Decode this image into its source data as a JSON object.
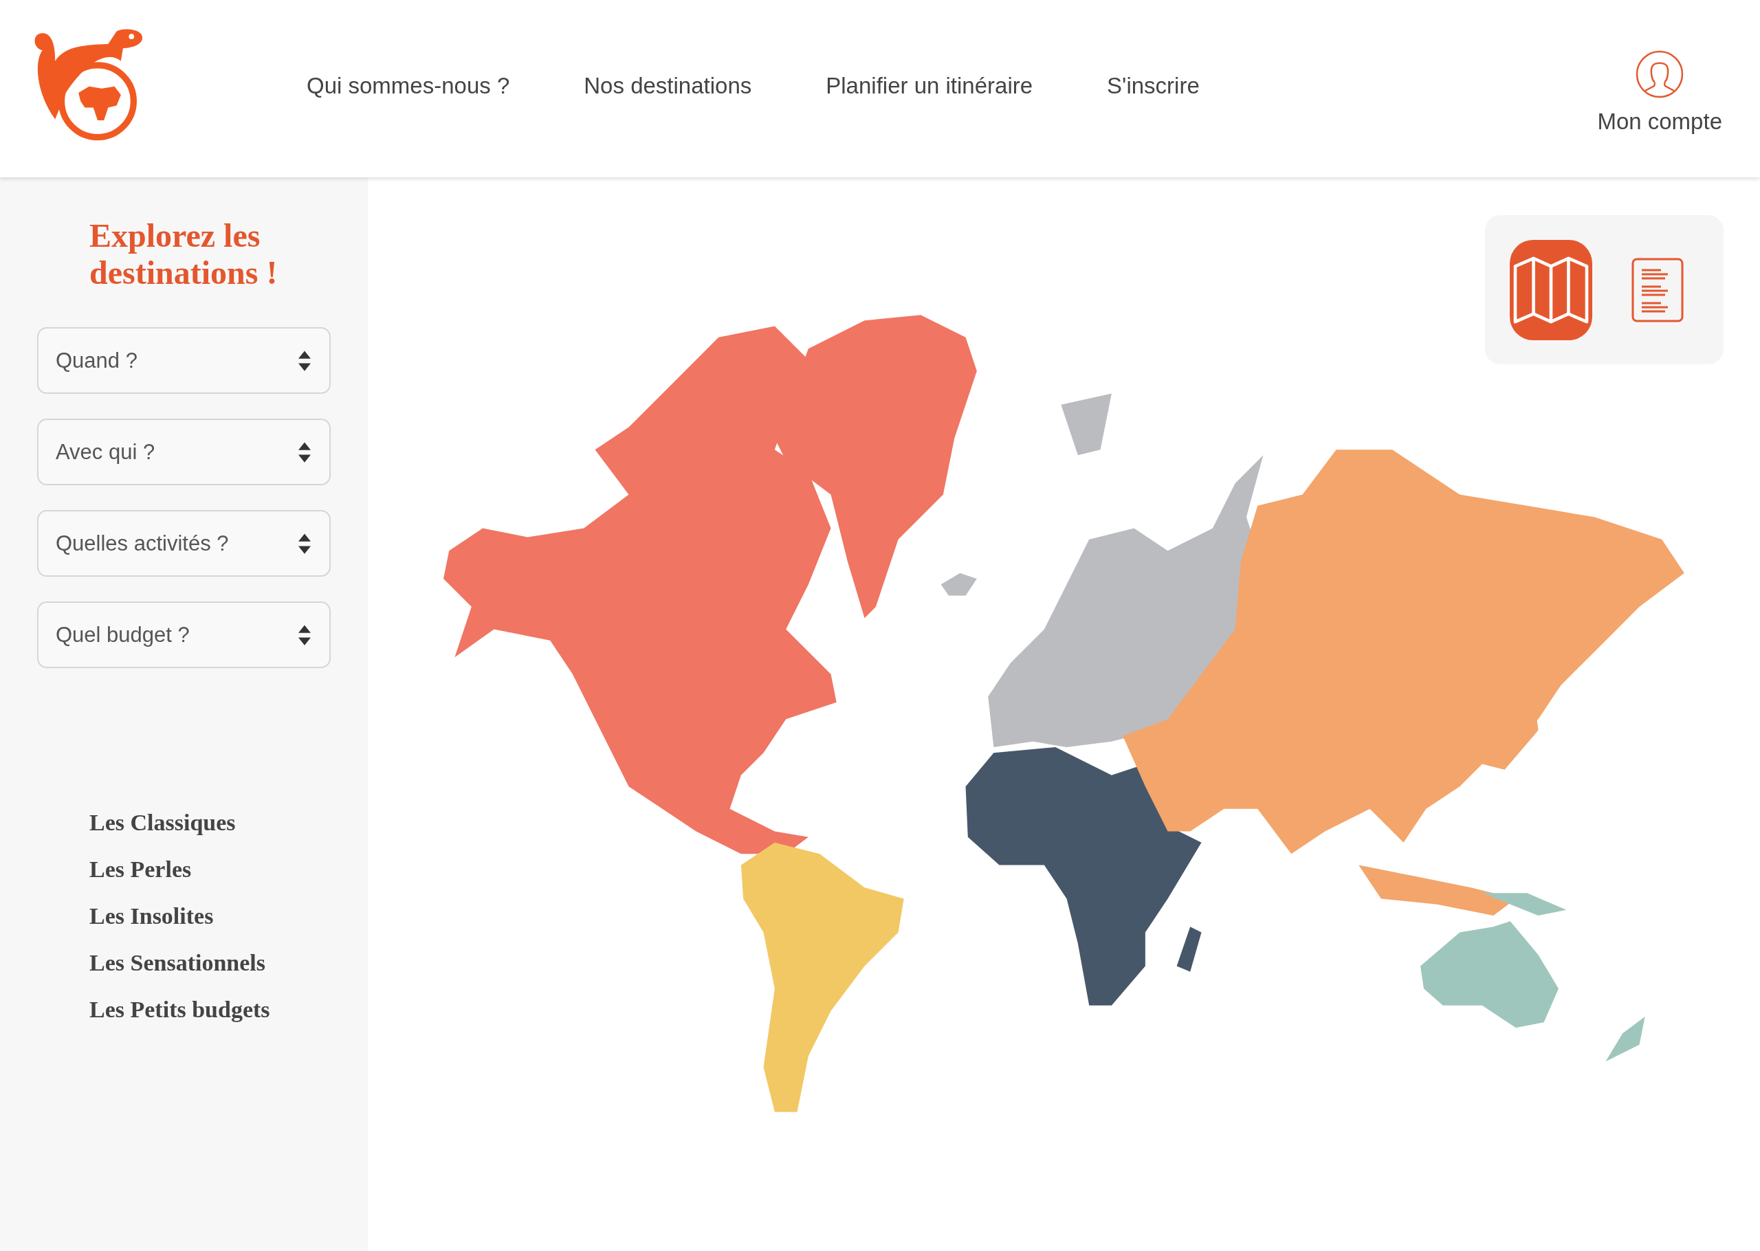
{
  "header": {
    "nav_links": [
      "Qui sommes-nous ?",
      "Nos destinations",
      "Planifier un itinéraire",
      "S'inscrire"
    ],
    "account": "Mon compte"
  },
  "sidebar": {
    "title": "Explorez les destinations !",
    "filters": [
      {
        "placeholder": "Quand ?"
      },
      {
        "placeholder": "Avec qui ?"
      },
      {
        "placeholder": "Quelles activités ?"
      },
      {
        "placeholder": "Quel budget ?"
      }
    ],
    "categories": [
      "Les Classiques",
      "Les Perles",
      "Les Insolites",
      "Les Sensationnels",
      "Les Petits budgets"
    ]
  },
  "view_toggle": [
    {
      "kind": "map",
      "selected": true
    },
    {
      "kind": "list",
      "selected": false
    }
  ],
  "map": {
    "regions": [
      {
        "color": "#f07562"
      },
      {
        "color": "#f2c864"
      },
      {
        "color": "#bbbcc0"
      },
      {
        "color": "#47576a"
      },
      {
        "color": "#f3a56b"
      },
      {
        "color": "#9fc6bc"
      }
    ]
  }
}
